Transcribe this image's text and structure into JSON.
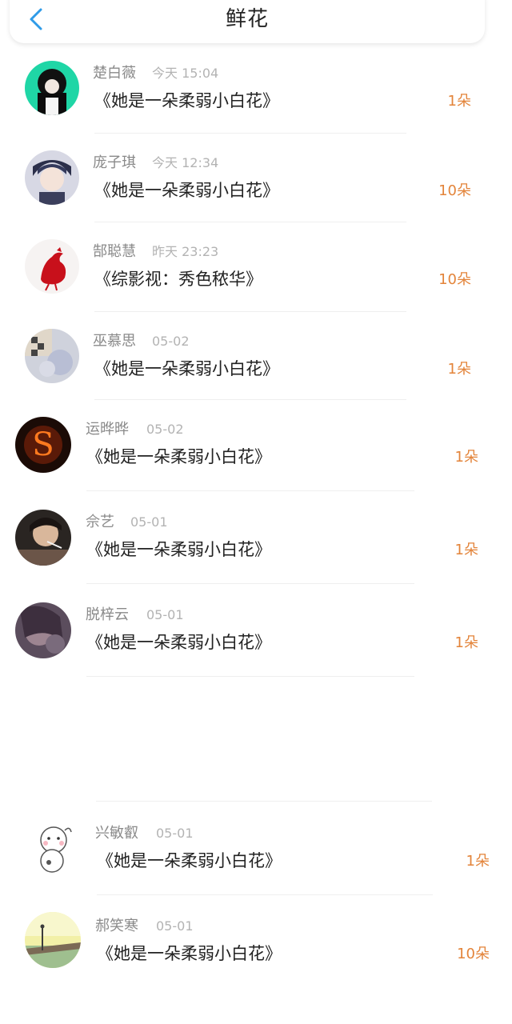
{
  "header": {
    "title": "鲜花"
  },
  "icons": {
    "back": "chevron-left-icon"
  },
  "colors": {
    "accent": "#e3843a",
    "back": "#2f9be8",
    "meta": "#8a8a8a"
  },
  "records": [
    {
      "name": "楚白薇",
      "time": "今天 15:04",
      "book": "《她是一朵柔弱小白花》",
      "count": "1朵"
    },
    {
      "name": "庞子琪",
      "time": "今天 12:34",
      "book": "《她是一朵柔弱小白花》",
      "count": "10朵"
    },
    {
      "name": "郜聪慧",
      "time": "昨天 23:23",
      "book": "《综影视：秀色秾华》",
      "count": "10朵"
    },
    {
      "name": "巫慕思",
      "time": "05-02",
      "book": "《她是一朵柔弱小白花》",
      "count": "1朵"
    },
    {
      "name": "运晔晔",
      "time": "05-02",
      "book": "《她是一朵柔弱小白花》",
      "count": "1朵"
    },
    {
      "name": "佘艺",
      "time": "05-01",
      "book": "《她是一朵柔弱小白花》",
      "count": "1朵"
    },
    {
      "name": "脱梓云",
      "time": "05-01",
      "book": "《她是一朵柔弱小白花》",
      "count": "1朵"
    },
    {
      "name": "兴敏叡",
      "time": "05-01",
      "book": "《她是一朵柔弱小白花》",
      "count": "1朵"
    },
    {
      "name": "郝笑寒",
      "time": "05-01",
      "book": "《她是一朵柔弱小白花》",
      "count": "10朵"
    }
  ]
}
